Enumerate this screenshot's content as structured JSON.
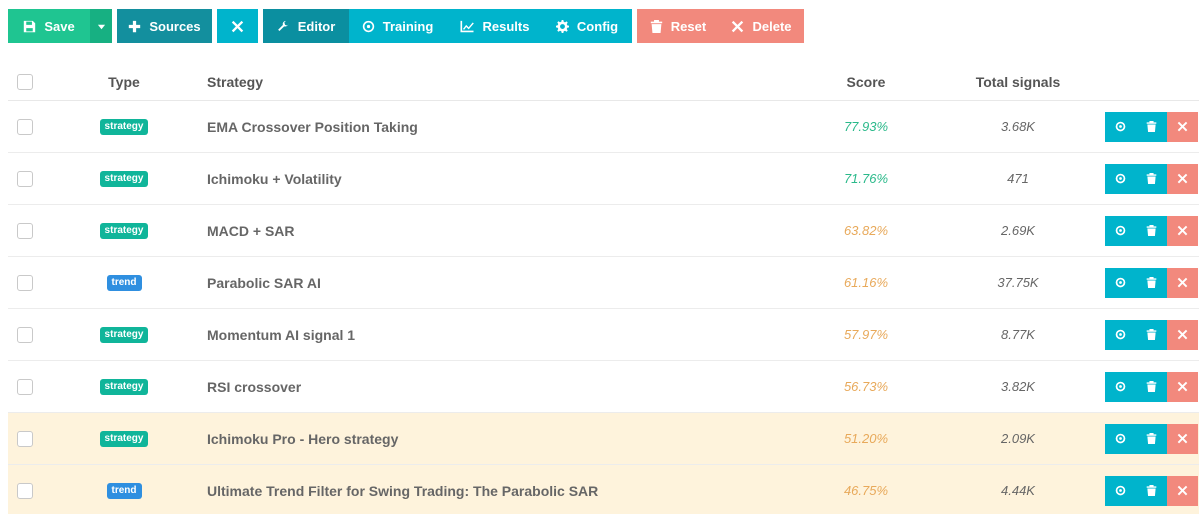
{
  "toolbar": {
    "save_label": "Save",
    "sources_label": "Sources",
    "editor_label": "Editor",
    "training_label": "Training",
    "results_label": "Results",
    "config_label": "Config",
    "reset_label": "Reset",
    "delete_label": "Delete"
  },
  "table": {
    "headers": {
      "type": "Type",
      "strategy": "Strategy",
      "score": "Score",
      "signals": "Total signals"
    },
    "rows": [
      {
        "type": "strategy",
        "strategy": "EMA Crossover Position Taking",
        "score": "77.93%",
        "signals": "3.68K",
        "score_color": "#2ab98a",
        "highlight": false
      },
      {
        "type": "strategy",
        "strategy": "Ichimoku + Volatility",
        "score": "71.76%",
        "signals": "471",
        "score_color": "#2ab98a",
        "highlight": false
      },
      {
        "type": "strategy",
        "strategy": "MACD + SAR",
        "score": "63.82%",
        "signals": "2.69K",
        "score_color": "#e8a95a",
        "highlight": false
      },
      {
        "type": "trend",
        "strategy": "Parabolic SAR AI",
        "score": "61.16%",
        "signals": "37.75K",
        "score_color": "#e8a95a",
        "highlight": false
      },
      {
        "type": "strategy",
        "strategy": "Momentum AI signal 1",
        "score": "57.97%",
        "signals": "8.77K",
        "score_color": "#e8a95a",
        "highlight": false
      },
      {
        "type": "strategy",
        "strategy": "RSI crossover",
        "score": "56.73%",
        "signals": "3.82K",
        "score_color": "#e8a95a",
        "highlight": false
      },
      {
        "type": "strategy",
        "strategy": "Ichimoku Pro - Hero strategy",
        "score": "51.20%",
        "signals": "2.09K",
        "score_color": "#e8a95a",
        "highlight": true
      },
      {
        "type": "trend",
        "strategy": "Ultimate Trend Filter for Swing Trading: The Parabolic SAR",
        "score": "46.75%",
        "signals": "4.44K",
        "score_color": "#e8a95a",
        "highlight": true
      }
    ]
  },
  "colors": {
    "save": "#1fc591",
    "sources": "#138f9e",
    "tabs": "#00b4cc",
    "active_tab": "#0b8fa0",
    "danger": "#f2897d",
    "highlight_row": "#fef3dc",
    "badge_strategy": "#10b59a",
    "badge_trend": "#2f8fe0"
  }
}
